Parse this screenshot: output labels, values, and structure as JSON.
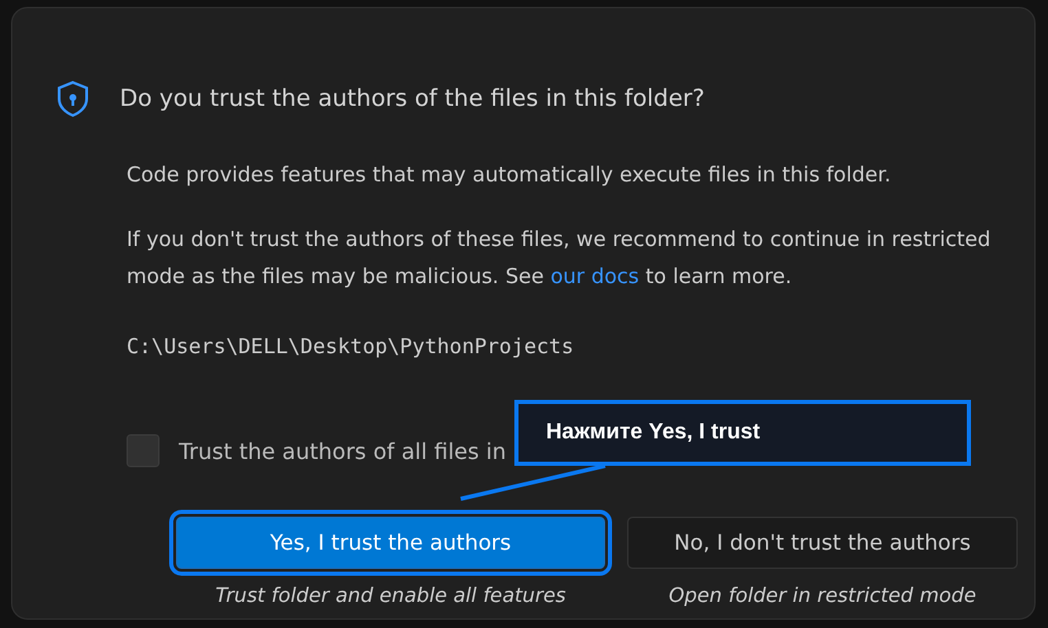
{
  "dialog": {
    "title": "Do you trust the authors of the files in this folder?",
    "paragraphs": [
      "Code provides features that may automatically execute files in this folder.",
      {
        "before": "If you don't trust the authors of these files, we recommend to continue in restricted mode as the files may be malicious. See",
        "link": "our docs",
        "after": "to learn more."
      }
    ],
    "path": "C:\\Users\\DELL\\Desktop\\PythonProjects",
    "checkbox": {
      "label": "Trust the authors of all files in",
      "checked": false
    },
    "buttons": [
      {
        "label": "Yes, I trust the authors",
        "caption": "Trust folder and enable all features",
        "kind": "primary"
      },
      {
        "label": "No, I don't trust the authors",
        "caption": "Open folder in restricted mode",
        "kind": "secondary"
      }
    ]
  },
  "callout": {
    "text": "Нажмите Yes, I trust"
  }
}
